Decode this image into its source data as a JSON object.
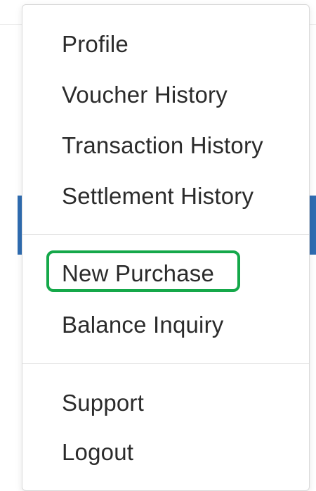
{
  "menu": {
    "groups": [
      {
        "items": [
          {
            "label": "Profile"
          },
          {
            "label": "Voucher History"
          },
          {
            "label": "Transaction History"
          },
          {
            "label": "Settlement History"
          }
        ]
      },
      {
        "items": [
          {
            "label": "New Purchase",
            "highlighted": true
          },
          {
            "label": "Balance Inquiry"
          }
        ]
      },
      {
        "items": [
          {
            "label": "Support"
          },
          {
            "label": "Logout"
          }
        ]
      }
    ]
  },
  "colors": {
    "highlight_border": "#15a84a",
    "menu_text": "#2b2b2b",
    "divider": "#e3e3e3",
    "background_accent": "#2f6db2"
  }
}
